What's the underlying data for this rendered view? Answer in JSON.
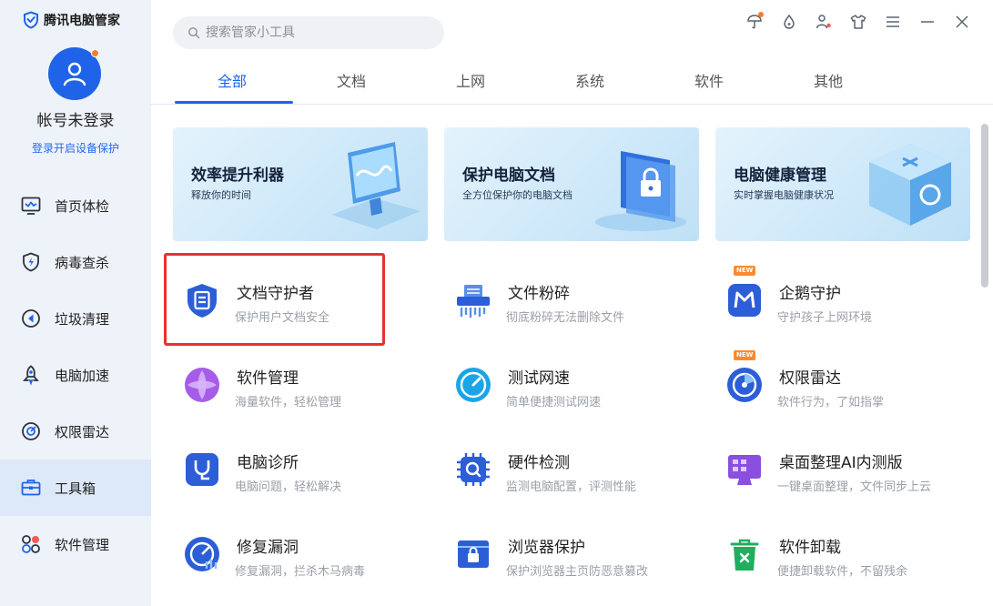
{
  "app": {
    "title": "腾讯电脑管家"
  },
  "user": {
    "name": "帐号未登录",
    "subtitle": "登录开启设备保护"
  },
  "sidebar": {
    "items": [
      {
        "label": "首页体检",
        "icon": "monitor-icon"
      },
      {
        "label": "病毒查杀",
        "icon": "shield-bolt-icon"
      },
      {
        "label": "垃圾清理",
        "icon": "broom-icon"
      },
      {
        "label": "电脑加速",
        "icon": "rocket-icon"
      },
      {
        "label": "权限雷达",
        "icon": "radar-icon"
      },
      {
        "label": "工具箱",
        "icon": "toolbox-icon",
        "active": true
      },
      {
        "label": "软件管理",
        "icon": "apps-icon"
      }
    ]
  },
  "search": {
    "placeholder": "搜索管家小工具"
  },
  "tabs": [
    "全部",
    "文档",
    "上网",
    "系统",
    "软件",
    "其他"
  ],
  "banners": [
    {
      "title": "效率提升利器",
      "subtitle": "释放你的时间"
    },
    {
      "title": "保护电脑文档",
      "subtitle": "全方位保护你的电脑文档"
    },
    {
      "title": "电脑健康管理",
      "subtitle": "实时掌握电脑健康状况"
    }
  ],
  "tools": [
    {
      "name": "文档守护者",
      "desc": "保护用户文档安全",
      "icon": "document-shield-icon"
    },
    {
      "name": "文件粉碎",
      "desc": "彻底粉碎无法删除文件",
      "icon": "shredder-icon"
    },
    {
      "name": "企鹅守护",
      "desc": "守护孩子上网环境",
      "icon": "penguin-guard-icon",
      "badge": "NEW"
    },
    {
      "name": "软件管理",
      "desc": "海量软件，轻松管理",
      "icon": "software-manage-icon"
    },
    {
      "name": "测试网速",
      "desc": "简单便捷测试网速",
      "icon": "speedometer-icon"
    },
    {
      "name": "权限雷达",
      "desc": "软件行为，了如指掌",
      "icon": "radar-icon",
      "badge": "NEW"
    },
    {
      "name": "电脑诊所",
      "desc": "电脑问题，轻松解决",
      "icon": "stethoscope-icon"
    },
    {
      "name": "硬件检测",
      "desc": "监测电脑配置，评测性能",
      "icon": "chip-icon"
    },
    {
      "name": "桌面整理AI内测版",
      "desc": "一键桌面整理，文件同步上云",
      "icon": "desktop-organize-icon"
    },
    {
      "name": "修复漏洞",
      "desc": "修复漏洞，拦杀木马病毒",
      "icon": "patch-icon"
    },
    {
      "name": "浏览器保护",
      "desc": "保护浏览器主页防恶意篡改",
      "icon": "browser-lock-icon"
    },
    {
      "name": "软件卸载",
      "desc": "便捷卸载软件，不留残余",
      "icon": "trash-icon"
    }
  ]
}
